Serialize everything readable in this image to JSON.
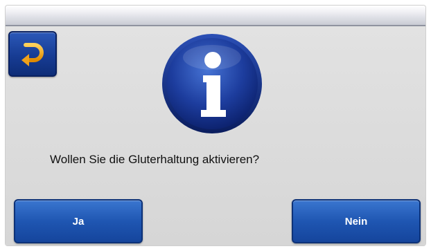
{
  "dialog": {
    "message": "Wollen Sie die Gluterhaltung aktivieren?",
    "yes_label": "Ja",
    "no_label": "Nein"
  },
  "icons": {
    "back": "back-arrow-icon",
    "info": "info-icon"
  },
  "colors": {
    "button_blue": "#1f56b2",
    "back_arrow": "#f2a81d",
    "info_blue": "#15338f"
  }
}
